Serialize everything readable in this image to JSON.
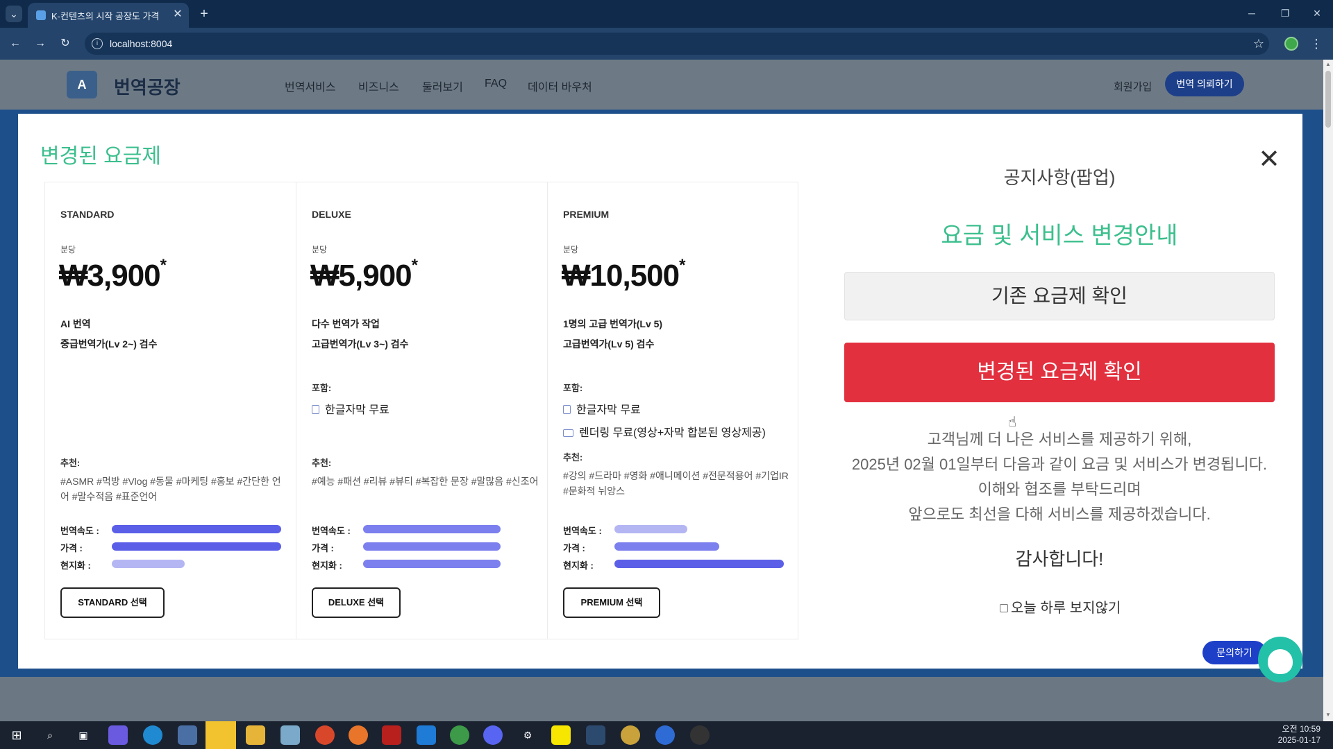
{
  "browser": {
    "tab_list_icon": "chevron-down-icon",
    "tab_title": "K-컨텐츠의 시작 공장도 가격",
    "tab_close": "✕",
    "new_tab": "+",
    "window_controls": [
      "─",
      "❐",
      "✕"
    ],
    "url": "localhost:8004"
  },
  "site": {
    "logo_text": "번역공장",
    "nav": [
      "번역서비스",
      "비즈니스",
      "둘러보기",
      "FAQ",
      "데이터 바우처"
    ],
    "signup": "회원가입",
    "request_button": "번역 의뢰하기"
  },
  "modal": {
    "heading": "변경된 요금제",
    "close": "✕",
    "plans": [
      {
        "name": "STANDARD",
        "per_min": "분당",
        "price": "₩3,900",
        "price_mark": "*",
        "features": [
          "AI 번역",
          "중급번역가(Lv 2~) 검수"
        ],
        "includes_label": "",
        "includes": [],
        "rec_label": "추천:",
        "rec_text": "#ASMR #먹방 #Vlog #동물 #마케팅 #홍보 #간단한 언어 #말수적음 #표준언어",
        "meters": [
          {
            "label": "번역속도 :",
            "value": 1.0
          },
          {
            "label": "가격 :",
            "value": 1.0
          },
          {
            "label": "현지화 :",
            "value": 0.43
          }
        ],
        "button": "STANDARD 선택"
      },
      {
        "name": "DELUXE",
        "per_min": "분당",
        "price": "₩5,900",
        "price_mark": "*",
        "features": [
          "다수 번역가 작업",
          "고급번역가(Lv 3~) 검수"
        ],
        "includes_label": "포함:",
        "includes": [
          "한글자막 무료"
        ],
        "rec_label": "추천:",
        "rec_text": "#예능 #패션 #리뷰 #뷰티 #복잡한 문장 #말많음 #신조어",
        "meters": [
          {
            "label": "번역속도 :",
            "value": 0.81
          },
          {
            "label": "가격 :",
            "value": 0.81
          },
          {
            "label": "현지화 :",
            "value": 0.81
          }
        ],
        "button": "DELUXE 선택"
      },
      {
        "name": "PREMIUM",
        "per_min": "분당",
        "price": "₩10,500",
        "price_mark": "*",
        "features": [
          "1명의 고급 번역가(Lv 5)",
          "고급번역가(Lv 5) 검수"
        ],
        "includes_label": "포함:",
        "includes": [
          "한글자막 무료",
          "렌더링 무료(영상+자막 합본된 영상제공)"
        ],
        "rec_label": "추천:",
        "rec_text": "#강의 #드라마 #영화 #애니메이션 #전문적용어 #기업IR #문화적 뉘앙스",
        "meters": [
          {
            "label": "번역속도 :",
            "value": 0.43
          },
          {
            "label": "가격 :",
            "value": 0.62
          },
          {
            "label": "현지화 :",
            "value": 1.0
          }
        ],
        "button": "PREMIUM 선택"
      }
    ],
    "notice": {
      "title": "공지사항(팝업)",
      "heading": "요금 및 서비스 변경안내",
      "old_plan_button": "기존 요금제 확인",
      "new_plan_button": "변경된 요금제 확인",
      "lines": [
        "고객님께 더 나은 서비스를 제공하기 위해,",
        "2025년 02월 01일부터 다음과 같이 요금 및 서비스가 변경됩니다.",
        "이해와 협조를 부탁드리며",
        "앞으로도 최선을 다해 서비스를 제공하겠습니다."
      ],
      "thanks": "감사합니다!",
      "dont_show": "오늘 하루 보지않기"
    }
  },
  "inquiry_button": "문의하기",
  "taskbar": {
    "icons": [
      "windows-icon",
      "search-icon",
      "task-view-icon",
      "copilot-icon",
      "edge-icon",
      "calculator-icon",
      "sticky-notes-icon",
      "file-explorer-icon",
      "notepad-icon",
      "chrome-icon",
      "firefox-icon",
      "filezilla-icon",
      "vscode-icon",
      "chrome-dev-icon",
      "discord-icon",
      "settings-icon",
      "kakaotalk-icon",
      "database-icon",
      "chrome-canary-icon",
      "chrome-beta-icon",
      "obs-icon"
    ],
    "time": "오전 10:59",
    "date": "2025-01-17"
  },
  "colors": {
    "accent_green": "#3bbf8d",
    "cta_red": "#e2303f",
    "meter_blue": "#5b5fe8",
    "brand_navy": "#1d3f8a"
  }
}
